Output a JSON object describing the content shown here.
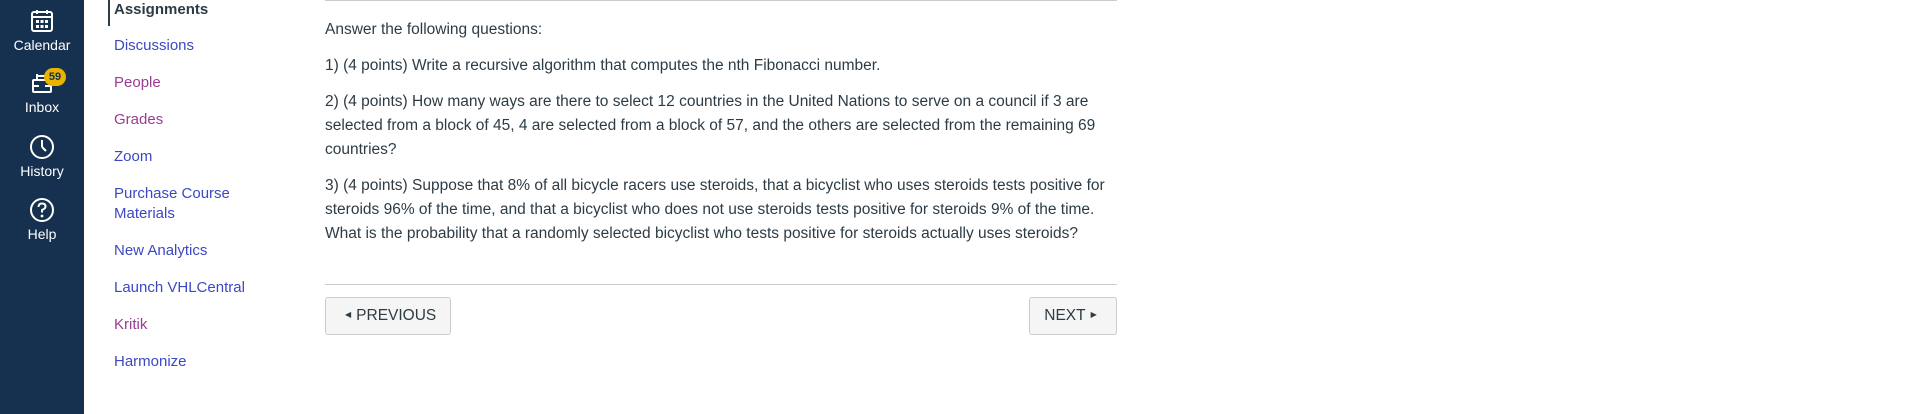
{
  "global_nav": {
    "items": [
      {
        "label": "Calendar",
        "icon": "calendar-icon"
      },
      {
        "label": "Inbox",
        "icon": "inbox-icon",
        "badge": "59"
      },
      {
        "label": "History",
        "icon": "clock-icon"
      },
      {
        "label": "Help",
        "icon": "help-icon"
      }
    ]
  },
  "course_nav": {
    "items": [
      {
        "label": "Assignments",
        "state": "active"
      },
      {
        "label": "Discussions",
        "state": "link"
      },
      {
        "label": "People",
        "state": "visited"
      },
      {
        "label": "Grades",
        "state": "visited"
      },
      {
        "label": "Zoom",
        "state": "link"
      },
      {
        "label": "Purchase Course",
        "label2": "Materials",
        "state": "link"
      },
      {
        "label": "New Analytics",
        "state": "link"
      },
      {
        "label": "Launch VHLCentral",
        "state": "link"
      },
      {
        "label": "Kritik",
        "state": "visited"
      },
      {
        "label": "Harmonize",
        "state": "link"
      }
    ]
  },
  "assignment": {
    "intro": "Answer the following questions:",
    "q1": "1) (4 points) Write a recursive algorithm that computes the nth Fibonacci number.",
    "q2_lines": [
      "2) (4 points) How many ways are there to select 12 countries in the United Nations to serve on a council if 3 are",
      "selected from a block of 45, 4 are selected from a block of 57, and the others are selected from the remaining 69",
      "countries?"
    ],
    "q3_lines": [
      "3) (4 points) Suppose that 8% of all bicycle racers use steroids, that a bicyclist who uses steroids tests positive for",
      "steroids 96% of the time, and that a bicyclist who does not use steroids tests positive for steroids 9% of the time.",
      "What is the probability that a randomly selected bicyclist who tests positive for steroids actually uses steroids?"
    ]
  },
  "pager": {
    "previous_label": "PREVIOUS",
    "next_label": "NEXT"
  },
  "colors": {
    "nav_bg": "#16304f",
    "link": "#3b48c2",
    "visited": "#9b3c93",
    "badge": "#e8b400",
    "text": "#2d3b45"
  }
}
